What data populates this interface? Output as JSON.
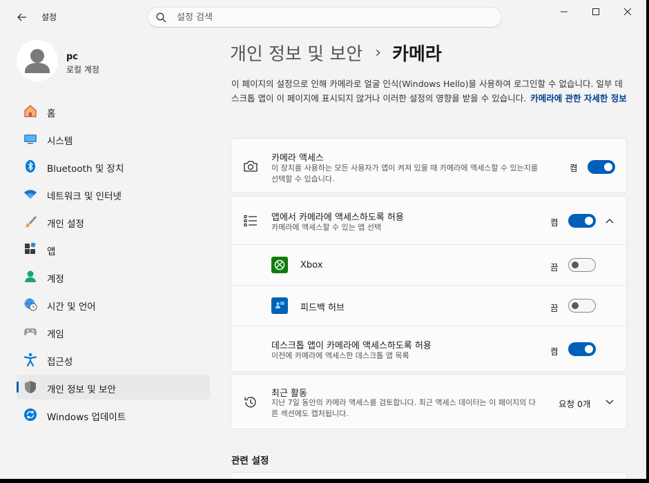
{
  "titlebar": {
    "app_title": "설정",
    "search_placeholder": "설정 검색"
  },
  "profile": {
    "name": "pc",
    "account_type": "로컬 계정"
  },
  "sidebar": {
    "items": [
      {
        "label": "홈",
        "icon": "home-icon"
      },
      {
        "label": "시스템",
        "icon": "system-icon"
      },
      {
        "label": "Bluetooth 및 장치",
        "icon": "bluetooth-icon"
      },
      {
        "label": "네트워크 및 인터넷",
        "icon": "wifi-icon"
      },
      {
        "label": "개인 설정",
        "icon": "brush-icon"
      },
      {
        "label": "앱",
        "icon": "apps-icon"
      },
      {
        "label": "계정",
        "icon": "person-icon"
      },
      {
        "label": "시간 및 언어",
        "icon": "globe-clock-icon"
      },
      {
        "label": "게임",
        "icon": "gamepad-icon"
      },
      {
        "label": "접근성",
        "icon": "accessibility-icon"
      },
      {
        "label": "개인 정보 및 보안",
        "icon": "shield-icon",
        "selected": true
      },
      {
        "label": "Windows 업데이트",
        "icon": "update-icon"
      }
    ]
  },
  "breadcrumb": {
    "parent": "개인 정보 및 보안",
    "separator": "›",
    "current": "카메라"
  },
  "intro": {
    "text": "이 페이지의 설정으로 인해 카메라로 얼굴 인식(Windows Hello)을 사용하여 로그인할 수 없습니다. 일부 데스크톱 앱이 이 페이지에 표시되지 않거나 이러한 설정의 영향을 받을 수 있습니다.",
    "link": "카메라에 관한 자세한 정보"
  },
  "camera_access": {
    "title": "카메라 액세스",
    "desc": "이 장치를 사용하는 모든 사용자가 앱이 켜져 있을 때 카메라에 액세스할 수 있는지를 선택할 수 있습니다.",
    "state": "켬",
    "on": true
  },
  "app_access": {
    "title": "앱에서 카메라에 액세스하도록 허용",
    "desc": "카메라에 액세스할 수 있는 앱 선택",
    "state": "켬",
    "on": true,
    "apps": [
      {
        "name": "Xbox",
        "state": "끔",
        "on": false,
        "tile_color": "#107c10"
      },
      {
        "name": "피드백 허브",
        "state": "끔",
        "on": false,
        "tile_color": "#0063b1"
      }
    ],
    "desktop": {
      "title": "데스크톱 앱이 카메라에 액세스하도록 허용",
      "desc": "이전에 카메라에 액세스한 데스크톱 앱 목록",
      "state": "켬",
      "on": true
    }
  },
  "recent_activity": {
    "title": "최근 활동",
    "desc": "지난 7일 동안의 카메라 액세스를 검토합니다. 최근 액세스 데이터는 이 페이지의 다른 섹션에도 캡처됩니다.",
    "count": "요청 0개"
  },
  "related": {
    "heading": "관련 설정"
  },
  "colors": {
    "accent": "#005fb8",
    "link": "#003e92",
    "background": "#f3f3f3",
    "card": "#fbfbfb"
  }
}
